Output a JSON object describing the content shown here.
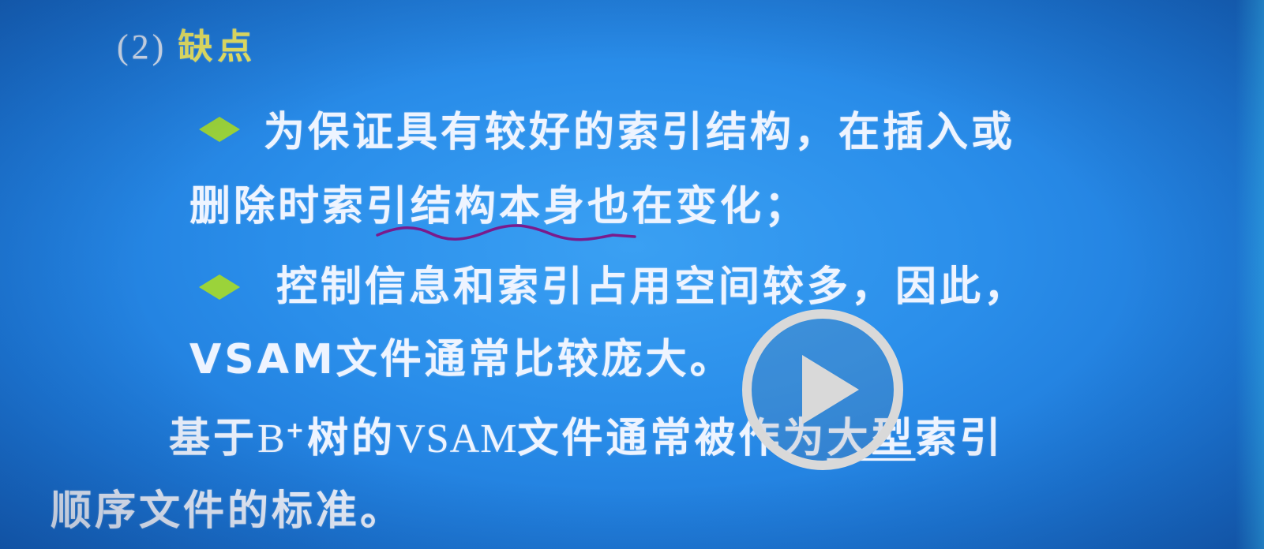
{
  "slide": {
    "heading_number": "(2)",
    "heading_title": "缺点",
    "bullet1_line1": "为保证具有较好的索引结构，在插入或",
    "bullet1_line2": "删除时索引结构本身也在变化；",
    "bullet2_line1": "控制信息和索引占用空间较多，因此，",
    "bullet2_line2": "VSAM文件通常比较庞大。",
    "para_pre_b": "基于",
    "para_b": "B",
    "para_plus": "+",
    "para_mid": "树的",
    "para_vsam": "VSAM",
    "para_rest": "文件通常被作为",
    "para_underlined": "大型",
    "para_end": "索引",
    "para_line2": "顺序文件的标准。"
  },
  "colors": {
    "background": "#2a8eea",
    "heading_title": "#f2ec63",
    "bullet": "#9bd33a",
    "annotation": "#7a1b8c",
    "play": "#d9d9d9"
  },
  "icons": {
    "bullet": "diamond-bullet-icon",
    "play": "play-icon"
  }
}
